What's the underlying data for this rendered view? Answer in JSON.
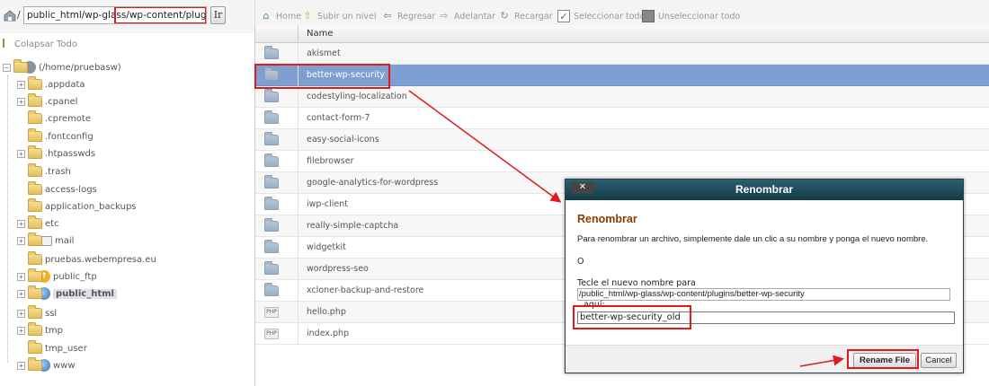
{
  "pathbar": {
    "prefix": "/",
    "path_value": "public_html/wp-glass/wp-content/plugins",
    "go_label": "Ir"
  },
  "tree": {
    "collapse_label": "Colapsar Todo",
    "root_label": "(/home/pruebasw)",
    "items": [
      {
        "label": ".appdata"
      },
      {
        "label": ".cpanel"
      },
      {
        "label": ".cpremote"
      },
      {
        "label": ".fontconfig"
      },
      {
        "label": ".htpasswds"
      },
      {
        "label": ".trash"
      },
      {
        "label": "access-logs"
      },
      {
        "label": "application_backups"
      },
      {
        "label": "etc"
      },
      {
        "label": "mail"
      },
      {
        "label": "pruebas.webempresa.eu"
      },
      {
        "label": "public_ftp"
      },
      {
        "label": "public_html"
      },
      {
        "label": "ssl"
      },
      {
        "label": "tmp"
      },
      {
        "label": "tmp_user"
      },
      {
        "label": "www"
      }
    ]
  },
  "toolbar": {
    "home": "Home",
    "up": "Subir un nivel",
    "back": "Regresar",
    "forward": "Adelantar",
    "reload": "Recargar",
    "select_all": "Seleccionar todo",
    "unselect_all": "Unseleccionar todo"
  },
  "filelist": {
    "header_name": "Name",
    "rows": [
      {
        "name": "akismet"
      },
      {
        "name": "better-wp-security"
      },
      {
        "name": "codestyling-localization"
      },
      {
        "name": "contact-form-7"
      },
      {
        "name": "easy-social-icons"
      },
      {
        "name": "filebrowser"
      },
      {
        "name": "google-analytics-for-wordpress"
      },
      {
        "name": "iwp-client"
      },
      {
        "name": "really-simple-captcha"
      },
      {
        "name": "widgetkit"
      },
      {
        "name": "wordpress-seo"
      },
      {
        "name": "xcloner-backup-and-restore"
      },
      {
        "name": "hello.php"
      },
      {
        "name": "index.php"
      }
    ]
  },
  "dialog": {
    "title": "Renombrar",
    "close": "✕",
    "heading": "Renombrar",
    "description": "Para renombrar un archivo, simplemente dale un clic a su nombre y ponga el nuevo nombre.",
    "or": "O",
    "label_path": "Tecle el nuevo nombre para",
    "current_path": "/public_html/wp-glass/wp-content/plugins/better-wp-security",
    "label_here": "aquí:",
    "new_name": "better-wp-security_old",
    "rename_button": "Rename File",
    "cancel_button": "Cancel"
  },
  "colors": {
    "highlight": "#e0191d",
    "selected_row": "#7f9fd1",
    "dialog_title": "#1e4a57",
    "heading": "#8a3b00"
  }
}
